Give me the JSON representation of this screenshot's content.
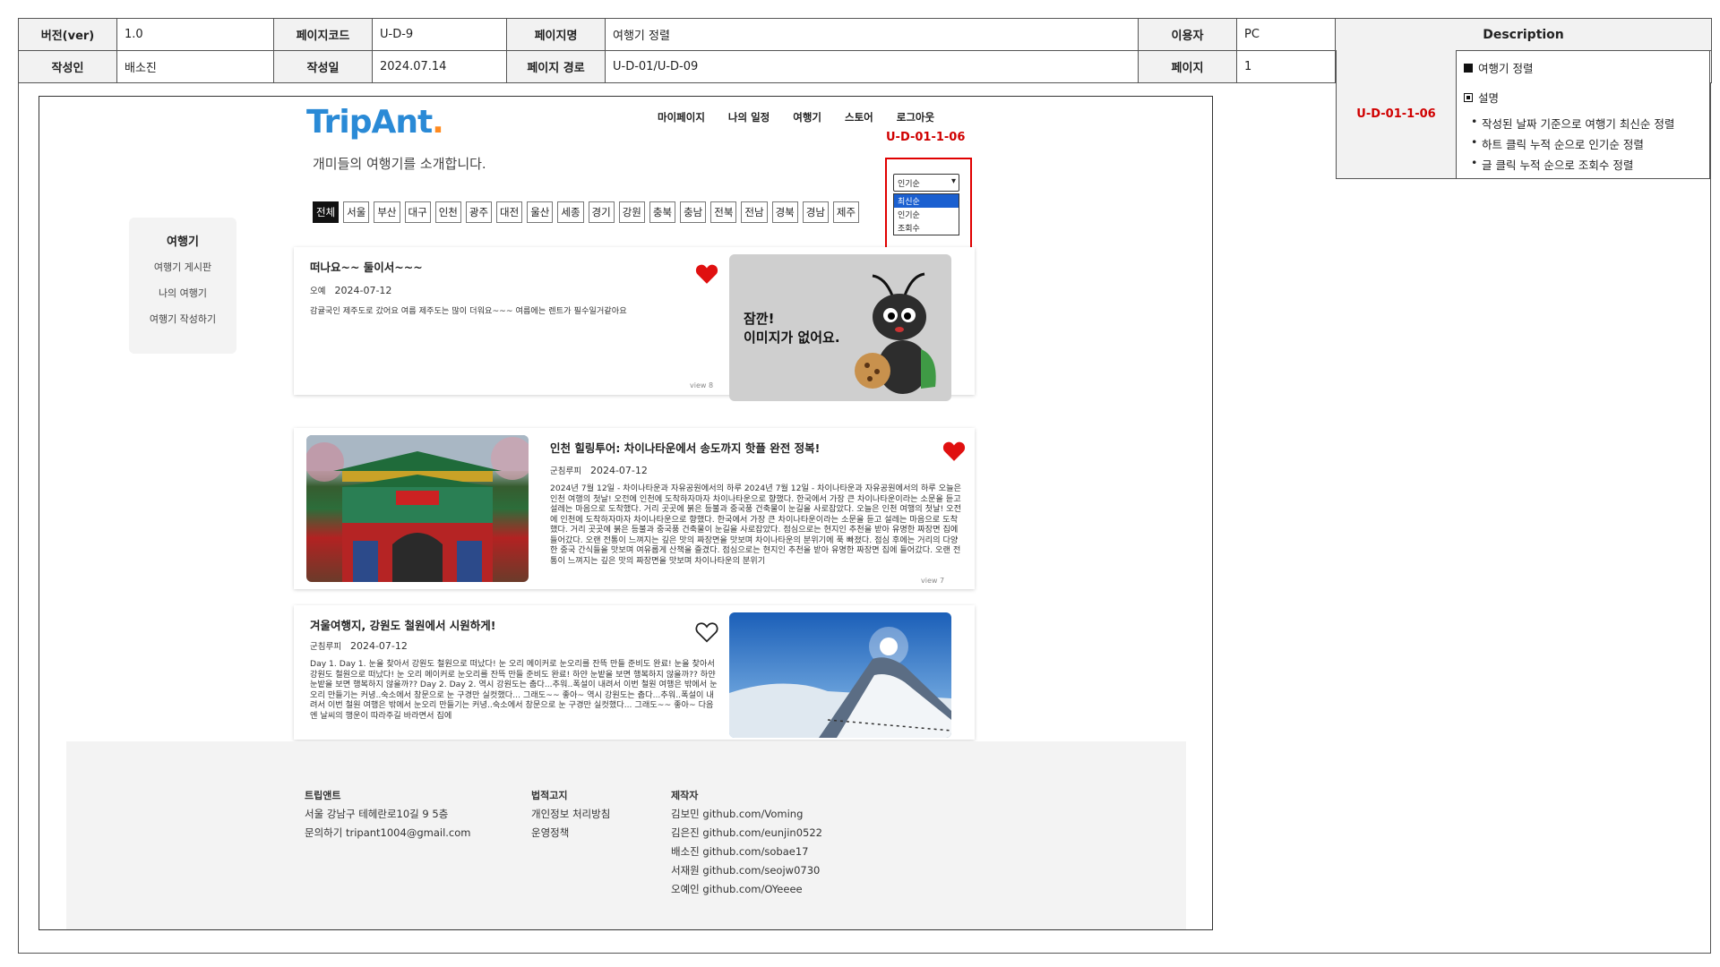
{
  "spec": {
    "version_label": "버전(ver)",
    "version": "1.0",
    "pagecode_label": "페이지코드",
    "pagecode": "U-D-9",
    "pagename_label": "페이지명",
    "pagename": "여행기 정렬",
    "user_label": "이용자",
    "user": "PC",
    "description_label": "Description",
    "author_label": "작성인",
    "author": "배소진",
    "date_label": "작성일",
    "date": "2024.07.14",
    "path_label": "페이지 경로",
    "path": "U-D-01/U-D-09",
    "page_label": "페이지",
    "page": "1"
  },
  "description": {
    "code": "U-D-01-1-06",
    "heading": "여행기 정렬",
    "sub": "설명",
    "bullets": [
      "작성된 날짜 기준으로 여행기 최신순 정렬",
      "하트 클릭 누적 순으로 인기순 정렬",
      "글 클릭 누적 순으로 조회수 정렬"
    ]
  },
  "screen": {
    "logo_main": "TripAnt",
    "logo_dot": ".",
    "tagline": "개미들의 여행기를 소개합니다.",
    "nav": [
      "마이페이지",
      "나의 일정",
      "여행기",
      "스토어",
      "로그아웃"
    ],
    "annotation_code": "U-D-01-1-06",
    "regions": [
      "전체",
      "서울",
      "부산",
      "대구",
      "인천",
      "광주",
      "대전",
      "울산",
      "세종",
      "경기",
      "강원",
      "충북",
      "충남",
      "전북",
      "전남",
      "경북",
      "경남",
      "제주"
    ],
    "sort": {
      "selected": "인기순",
      "options": [
        "최신순",
        "인기순",
        "조회수"
      ],
      "highlighted": "최신순"
    },
    "sidebar": {
      "title": "여행기",
      "items": [
        "여행기 게시판",
        "나의 여행기",
        "여행기 작성하기"
      ]
    },
    "posts": [
      {
        "title": "떠나요~~ 둘이서~~~",
        "author": "오예",
        "date": "2024-07-12",
        "text": "감귤국인 제주도로 갔어요 여름 제주도는 많이 더워요~~~ 여름에는 렌트가 필수일거같아요",
        "view": "view 8",
        "liked": true,
        "image_text": "잠깐!\n이미지가 없어요."
      },
      {
        "title": "인천 힐링투어: 차이나타운에서 송도까지 핫플 완전 정복!",
        "author": "군침루피",
        "date": "2024-07-12",
        "text": "2024년 7월 12일 - 차이나타운과 자유공원에서의 하루 2024년 7월 12일 - 차이나타운과 자유공원에서의 하루 오늘은 인천 여행의 첫날! 오전에 인천에 도착하자마자 차이나타운으로 향했다. 한국에서 가장 큰 차이나타운이라는 소문을 듣고 설레는 마음으로 도착했다. 거리 곳곳에 붉은 등불과 중국풍 건축물이 눈길을 사로잡았다. 오늘은 인천 여행의 첫날! 오전에 인천에 도착하자마자 차이나타운으로 향했다. 한국에서 가장 큰 차이나타운이라는 소문을 듣고 설레는 마음으로 도착했다. 거리 곳곳에 붉은 등불과 중국풍 건축물이 눈길을 사로잡았다. 점심으로는 현지인 추천을 받아 유명한 짜장면 집에 들어갔다. 오랜 전통이 느껴지는 깊은 맛의 짜장면을 맛보며 차이나타운의 분위기에 푹 빠졌다. 점심 후에는 거리의 다양한 중국 간식들을 맛보며 여유롭게 산책을 즐겼다. 점심으로는 현지인 추천을 받아 유명한 짜장면 집에 들어갔다. 오랜 전통이 느껴지는 깊은 맛의 짜장면을 맛보며 차이나타운의 분위기",
        "view": "view 7",
        "liked": true
      },
      {
        "title": "겨울여행지, 강원도 철원에서 시원하게!",
        "author": "군침루피",
        "date": "2024-07-12",
        "text": "Day 1. Day 1. 눈을 찾아서 강원도 철원으로 떠났다! 눈 오리 메이커로 눈오리를 잔뜩 만들 준비도 완료! 눈을 찾아서 강원도 철원으로 떠났다! 눈 오리 메이커로 눈오리를 잔뜩 만들 준비도 완료! 하얀 눈밭을 보면 행복하지 않을까?? 하얀 눈밭을 보면 행복하지 않을까?? Day 2. Day 2. 역시 강원도는 춥다...추워..폭설이 내려서 이번 철원 여행은 밖에서 눈오리 만들기는 커녕..숙소에서 창문으로 눈 구경만 실컷했다... 그래도~~ 좋아~ 역시 강원도는 춥다...추워..폭설이 내려서 이번 철원 여행은 밖에서 눈오리 만들기는 커녕..숙소에서 창문으로 눈 구경만 실컷했다... 그래도~~ 좋아~ 다음엔 날씨의 행운이 따라주길 바라면서 집에",
        "liked": false
      }
    ],
    "footer": {
      "col1": {
        "title": "트립앤트",
        "lines": [
          "서울 강남구 테헤란로10길 9 5층",
          "문의하기 tripant1004@gmail.com"
        ]
      },
      "col2": {
        "title": "법적고지",
        "lines": [
          "개인정보 처리방침",
          "운영정책"
        ]
      },
      "col3": {
        "title": "제작자",
        "lines": [
          "김보민 github.com/Voming",
          "김은진 github.com/eunjin0522",
          "배소진 github.com/sobae17",
          "서재원 github.com/seojw0730",
          "오예인 github.com/OYeeee"
        ]
      }
    }
  },
  "colors": {
    "accent_red": "#d00000",
    "logo_blue": "#2a8ad6",
    "logo_orange": "#ff8a1f",
    "heart": "#e01010"
  }
}
